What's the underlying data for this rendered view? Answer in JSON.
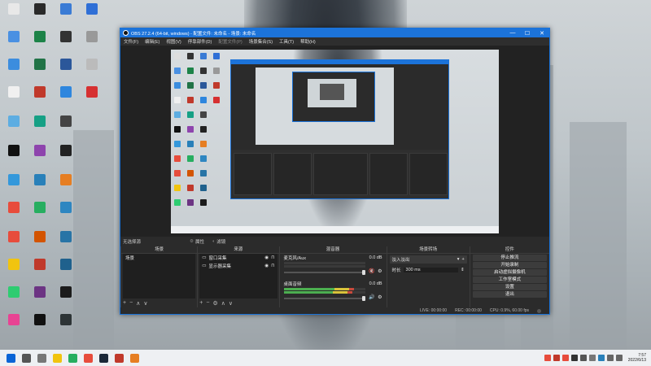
{
  "window": {
    "title": "OBS 27.2.4 (64-bit, windows) - 配置文件: 未命名 - 场景: 未命名",
    "minimize": "—",
    "maximize": "☐",
    "close": "✕"
  },
  "menu": {
    "items": [
      "文件(F)",
      "编辑(E)",
      "视图(V)",
      "停靠部件(D)",
      "配置文件(P)",
      "场景集合(S)",
      "工具(T)",
      "帮助(H)"
    ]
  },
  "scenes_bar": {
    "label": "无选择源",
    "properties": "属性",
    "filters": "滤镜"
  },
  "scenes_dock": {
    "title": "场景",
    "items": [
      "场景"
    ]
  },
  "sources_dock": {
    "title": "来源",
    "items": [
      "窗口采集",
      "显示器采集"
    ]
  },
  "mixer_dock": {
    "title": "混音器",
    "tracks": [
      {
        "name": "麦克风/Aux",
        "db": "0.0 dB",
        "level": 0.0,
        "muted": true
      },
      {
        "name": "桌面音频",
        "db": "0.0 dB",
        "level": 0.82,
        "muted": false
      }
    ]
  },
  "transitions_dock": {
    "title": "场景转场",
    "selected": "淡入淡出",
    "duration_label": "时长",
    "duration_value": "300 ms"
  },
  "controls_dock": {
    "title": "控件",
    "buttons": [
      "停止推流",
      "开始录制",
      "启动虚拟摄像机",
      "工作室模式",
      "设置",
      "退出"
    ]
  },
  "status": {
    "live": "LIVE: 00:00:00",
    "rec": "REC: 00:00:00",
    "cpu": "CPU: 0.9%, 60.00 fps"
  },
  "taskbar": {
    "time": "7:57",
    "date": "2022/6/13"
  },
  "colors": {
    "accent": "#1c73d9",
    "obs_bg": "#2b2b2b"
  }
}
